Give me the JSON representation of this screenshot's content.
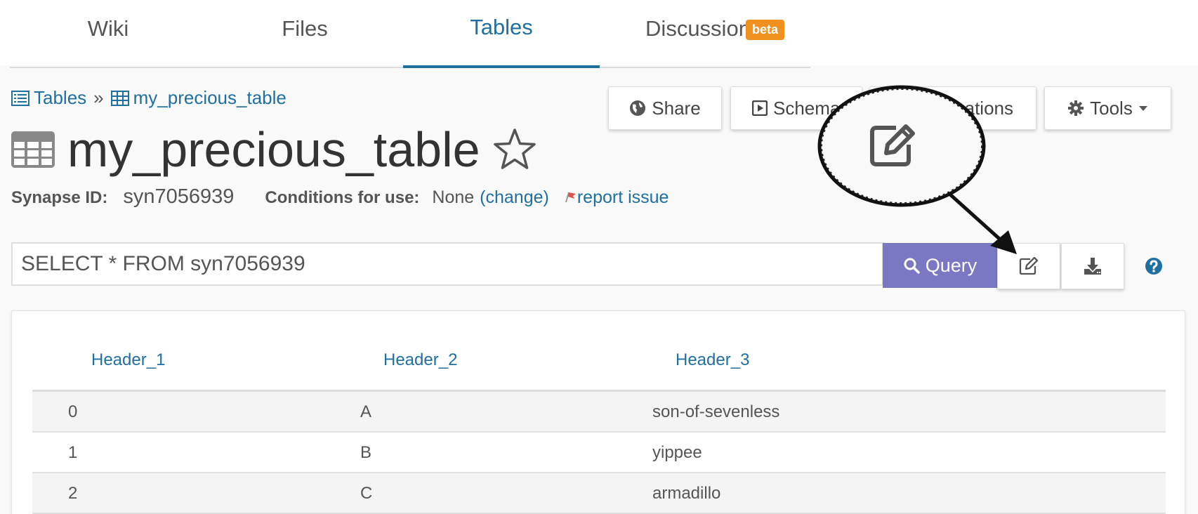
{
  "tabs": [
    {
      "label": "Wiki",
      "active": false
    },
    {
      "label": "Files",
      "active": false
    },
    {
      "label": "Tables",
      "active": true
    },
    {
      "label": "Discussion",
      "active": false
    }
  ],
  "badge": "beta",
  "breadcrumb": {
    "root": "Tables",
    "separator": "»",
    "current": "my_precious_table"
  },
  "actions": {
    "share": "Share",
    "schema": "Schema",
    "annotations": "ations",
    "tools": "Tools"
  },
  "title": "my_precious_table",
  "meta": {
    "synapse_id_label": "Synapse ID:",
    "synapse_id": "syn7056939",
    "conditions_label": "Conditions for use:",
    "conditions_value": "None",
    "change_link": "(change)",
    "report_link": "report issue"
  },
  "query": {
    "value": "SELECT * FROM syn7056939",
    "button_label": "Query"
  },
  "table": {
    "headers": [
      "Header_1",
      "Header_2",
      "Header_3"
    ],
    "rows": [
      [
        "0",
        "A",
        "son-of-sevenless"
      ],
      [
        "1",
        "B",
        "yippee"
      ],
      [
        "2",
        "C",
        "armadillo"
      ]
    ]
  },
  "colors": {
    "link": "#1f6f9f",
    "query_button": "#7a78c2",
    "badge": "#f0901e",
    "report_flag": "#d9534f"
  },
  "icons": [
    "list-icon",
    "table-icon",
    "globe-icon",
    "play-square-icon",
    "gear-icon",
    "caret-down-icon",
    "star-icon",
    "flag-icon",
    "search-icon",
    "edit-icon",
    "download-icon",
    "help-icon"
  ]
}
